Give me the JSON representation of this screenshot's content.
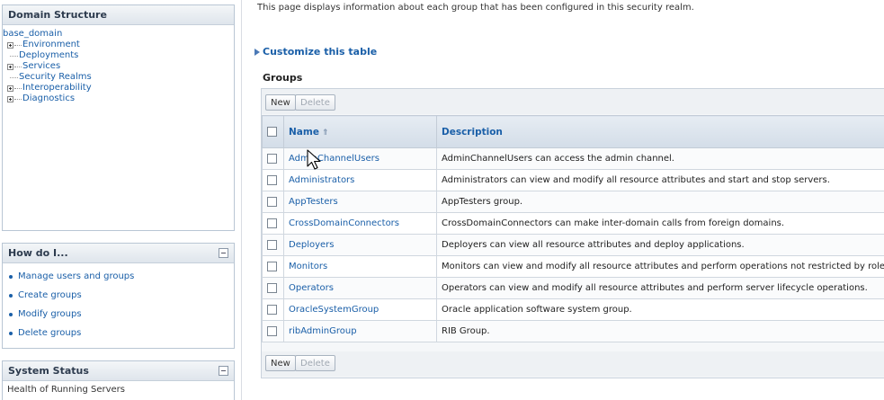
{
  "sidebar": {
    "domain_structure": {
      "title": "Domain Structure",
      "root": "base_domain",
      "items": [
        {
          "label": "Environment",
          "expandable": true
        },
        {
          "label": "Deployments",
          "expandable": false
        },
        {
          "label": "Services",
          "expandable": true
        },
        {
          "label": "Security Realms",
          "expandable": false
        },
        {
          "label": "Interoperability",
          "expandable": true
        },
        {
          "label": "Diagnostics",
          "expandable": true
        }
      ]
    },
    "how_do_i": {
      "title": "How do I...",
      "links": [
        "Manage users and groups",
        "Create groups",
        "Modify groups",
        "Delete groups"
      ]
    },
    "system_status": {
      "title": "System Status",
      "subtitle": "Health of Running Servers"
    }
  },
  "main": {
    "intro": "This page displays information about each group that has been configured in this security realm.",
    "customize_link": "Customize this table",
    "table_title": "Groups",
    "buttons": {
      "new": "New",
      "delete": "Delete"
    },
    "columns": {
      "name": "Name",
      "description": "Description"
    },
    "rows": [
      {
        "name": "AdminChannelUsers",
        "description": "AdminChannelUsers can access the admin channel."
      },
      {
        "name": "Administrators",
        "description": "Administrators can view and modify all resource attributes and start and stop servers."
      },
      {
        "name": "AppTesters",
        "description": "AppTesters group."
      },
      {
        "name": "CrossDomainConnectors",
        "description": "CrossDomainConnectors can make inter-domain calls from foreign domains."
      },
      {
        "name": "Deployers",
        "description": "Deployers can view all resource attributes and deploy applications."
      },
      {
        "name": "Monitors",
        "description": "Monitors can view and modify all resource attributes and perform operations not restricted by roles."
      },
      {
        "name": "Operators",
        "description": "Operators can view and modify all resource attributes and perform server lifecycle operations."
      },
      {
        "name": "OracleSystemGroup",
        "description": "Oracle application software system group."
      },
      {
        "name": "ribAdminGroup",
        "description": "RIB Group."
      }
    ]
  },
  "colors": {
    "link": "#1a5fa8",
    "header_bg": "#d3dde8",
    "panel_border": "#b9c6d4"
  }
}
